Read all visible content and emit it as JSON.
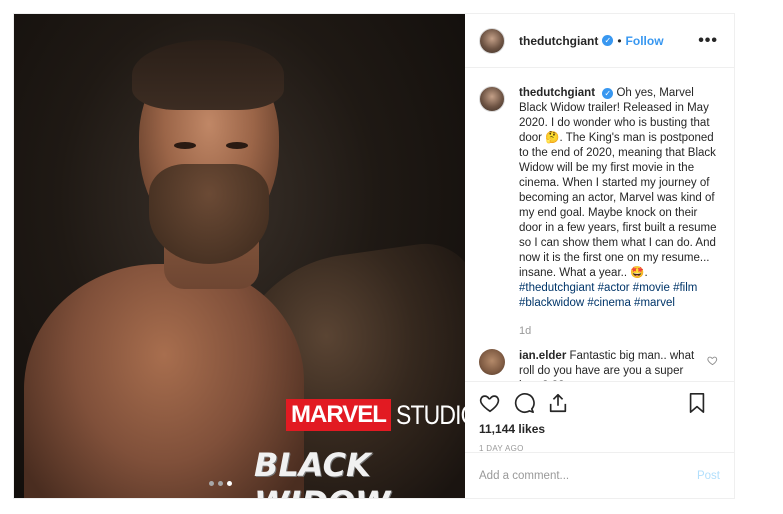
{
  "post": {
    "username": "thedutchgiant",
    "separator": "•",
    "follow_label": "Follow",
    "more_label": "•••",
    "media": {
      "brand": "MARVEL",
      "studios": "STUDIOS",
      "movie_title": "BLACK WIDOW",
      "carousel_dots": 3,
      "active_dot": 3
    },
    "caption": {
      "username": "thedutchgiant",
      "text": "Oh yes, Marvel Black Widow trailer! Released in May 2020. I do wonder who is busting that door 🤔. The King's man is postponed to the end of 2020, meaning that Black Widow will be my first movie in the cinema. When I started my journey of becoming an actor, Marvel was kind of my end goal. Maybe knock on their door in a few years, first built a resume so I can show them what I can do. And now it is the first one on my resume... insane. What a year.. 🤩.",
      "hashtags": "#thedutchgiant #actor #movie #film #blackwidow #cinema #marvel",
      "time": "1d"
    },
    "comments": [
      {
        "username": "ian.elder",
        "text": "Fantastic big man.. what roll do you have are you a super hero? ??"
      }
    ],
    "likes": "11,144 likes",
    "time_ago": "1 DAY AGO",
    "add_comment_placeholder": "Add a comment...",
    "post_label": "Post"
  }
}
